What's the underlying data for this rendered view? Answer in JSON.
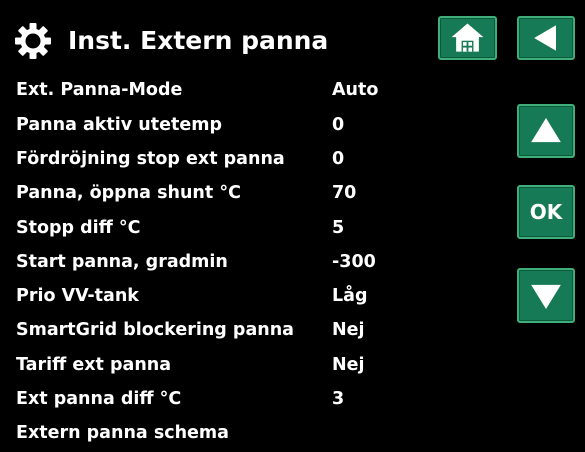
{
  "header": {
    "title": "Inst. Extern panna"
  },
  "buttons": {
    "ok_label": "OK"
  },
  "settings": [
    {
      "label": "Ext. Panna-Mode",
      "value": "Auto"
    },
    {
      "label": "Panna aktiv utetemp",
      "value": "0"
    },
    {
      "label": "Fördröjning stop ext panna",
      "value": "0"
    },
    {
      "label": "Panna, öppna shunt °C",
      "value": "70"
    },
    {
      "label": "Stopp diff °C",
      "value": "5"
    },
    {
      "label": "Start panna, gradmin",
      "value": "-300"
    },
    {
      "label": "Prio VV-tank",
      "value": "Låg"
    },
    {
      "label": "SmartGrid blockering panna",
      "value": "Nej"
    },
    {
      "label": "Tariff ext panna",
      "value": "Nej"
    },
    {
      "label": "Ext panna diff °C",
      "value": "3"
    },
    {
      "label": "Extern panna schema",
      "value": ""
    }
  ],
  "colors": {
    "background": "#000000",
    "text": "#ffffff",
    "button": "#157a55",
    "button_border": "#3fae7a"
  },
  "icons": [
    "gear-icon",
    "home-icon",
    "back-arrow-icon",
    "up-arrow-icon",
    "down-arrow-icon"
  ]
}
